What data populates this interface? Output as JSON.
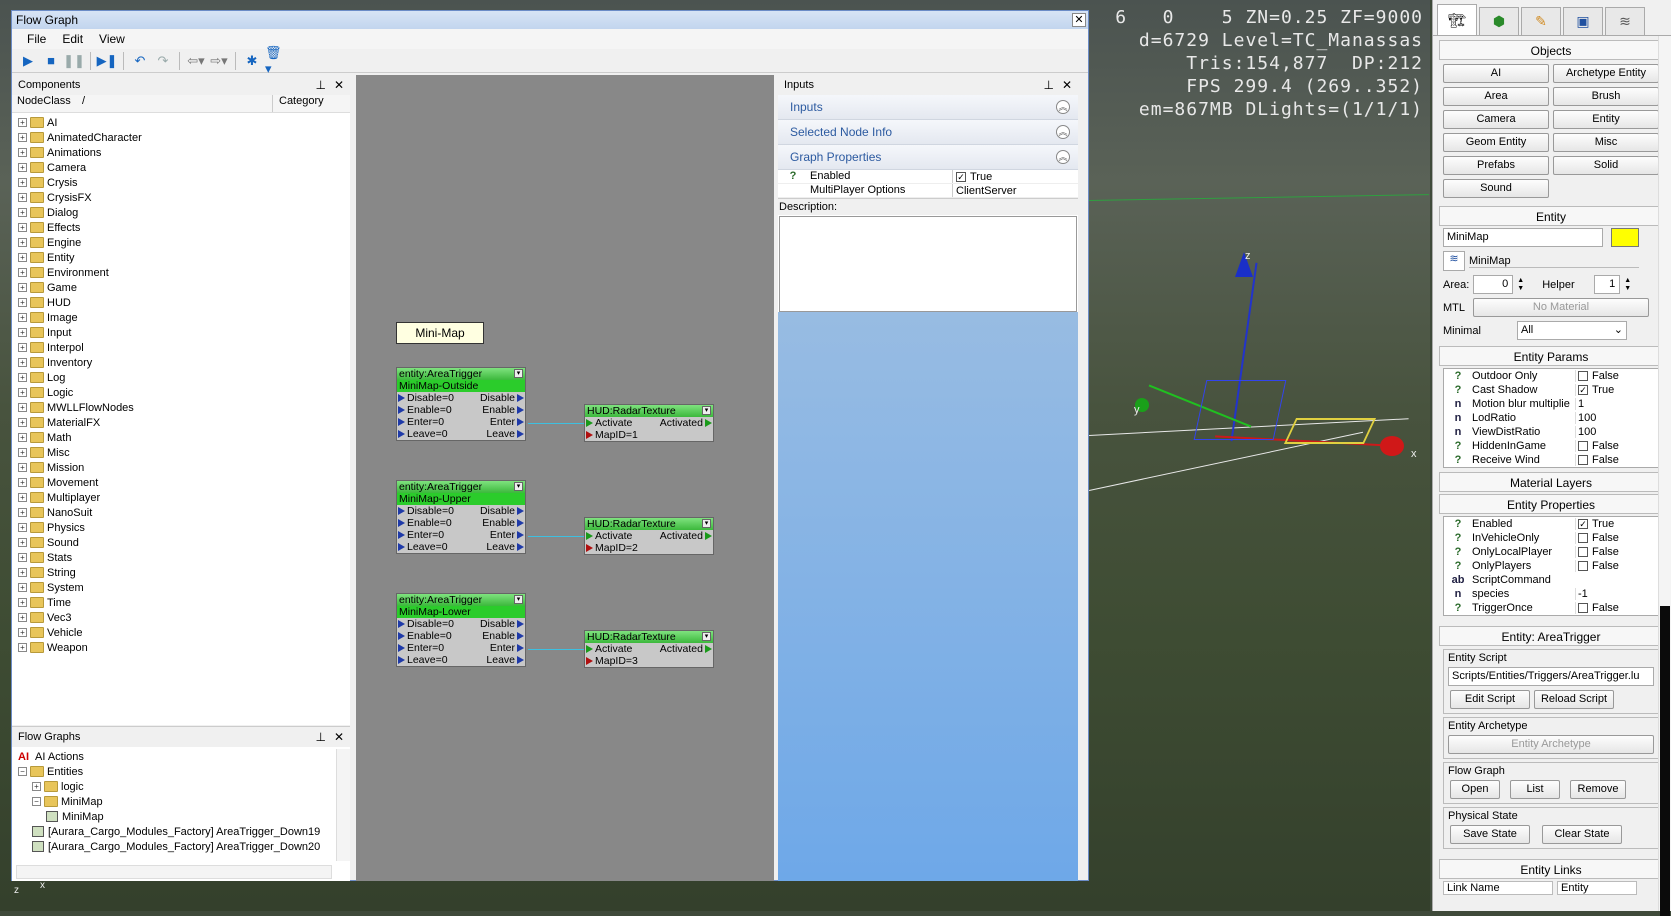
{
  "viewport": {
    "stats": [
      "6   0    5 ZN=0.25 ZF=9000",
      "d=6729 Level=TC_Manassas",
      "Tris:154,877  DP:212",
      "FPS 299.4 (269..352)",
      "em=867MB DLights=(1/1/1)"
    ],
    "axis_x": "x",
    "axis_y": "y",
    "axis_z": "z",
    "bottom_x": "x",
    "bottom_z": "z"
  },
  "window": {
    "title": "Flow Graph",
    "close": "✕"
  },
  "menu": [
    "File",
    "Edit",
    "View"
  ],
  "components": {
    "title": "Components",
    "col_nodeclass": "NodeClass",
    "col_sort": "/",
    "col_category": "Category",
    "items": [
      "AI",
      "AnimatedCharacter",
      "Animations",
      "Camera",
      "Crysis",
      "CrysisFX",
      "Dialog",
      "Effects",
      "Engine",
      "Entity",
      "Environment",
      "Game",
      "HUD",
      "Image",
      "Input",
      "Interpol",
      "Inventory",
      "Log",
      "Logic",
      "MWLLFlowNodes",
      "MaterialFX",
      "Math",
      "Misc",
      "Mission",
      "Movement",
      "Multiplayer",
      "NanoSuit",
      "Physics",
      "Sound",
      "Stats",
      "String",
      "System",
      "Time",
      "Vec3",
      "Vehicle",
      "Weapon"
    ]
  },
  "flowgraphs": {
    "title": "Flow Graphs",
    "items": [
      {
        "icon": "AI",
        "label": "AI Actions",
        "level": 0
      },
      {
        "label": "Entities",
        "level": 0
      },
      {
        "label": "logic",
        "level": 1
      },
      {
        "label": "MiniMap",
        "level": 1
      },
      {
        "label": "MiniMap",
        "level": 2
      },
      {
        "label": "[Aurara_Cargo_Modules_Factory] AreaTrigger_Down19",
        "level": 1
      },
      {
        "label": "[Aurara_Cargo_Modules_Factory] AreaTrigger_Down20",
        "level": 1
      }
    ]
  },
  "graph": {
    "comment": "Mini-Map",
    "triggers": [
      {
        "type": "entity:AreaTrigger",
        "name": "MiniMap-Outside"
      },
      {
        "type": "entity:AreaTrigger",
        "name": "MiniMap-Upper"
      },
      {
        "type": "entity:AreaTrigger",
        "name": "MiniMap-Lower"
      }
    ],
    "trigger_ports": {
      "in": [
        "Disable=0",
        "Enable=0",
        "Enter=0",
        "Leave=0"
      ],
      "out": [
        "Disable",
        "Enable",
        "Enter",
        "Leave"
      ]
    },
    "radars": [
      {
        "type": "HUD:RadarTexture",
        "in": "Activate",
        "out": "Activated",
        "param": "MapID=1"
      },
      {
        "type": "HUD:RadarTexture",
        "in": "Activate",
        "out": "Activated",
        "param": "MapID=2"
      },
      {
        "type": "HUD:RadarTexture",
        "in": "Activate",
        "out": "Activated",
        "param": "MapID=3"
      }
    ]
  },
  "inputs": {
    "title": "Inputs",
    "sections": [
      "Inputs",
      "Selected Node Info",
      "Graph Properties"
    ],
    "props": [
      {
        "q": "?",
        "name": "Enabled",
        "value": "True",
        "check": true
      },
      {
        "q": "",
        "name": "MultiPlayer Options",
        "value": "ClientServer",
        "check": false
      }
    ],
    "description_label": "Description:"
  },
  "right": {
    "objects_title": "Objects",
    "objects": [
      "AI",
      "Archetype Entity",
      "Area",
      "Brush",
      "Camera",
      "Entity",
      "Geom Entity",
      "Misc",
      "Prefabs",
      "Solid",
      "Sound"
    ],
    "entity_title": "Entity",
    "entity_name": "MiniMap",
    "entity_color": "#ffff00",
    "layer": "MiniMap",
    "area_label": "Area:",
    "area_value": "0",
    "helper_label": "Helper",
    "helper_value": "1",
    "mtl_label": "MTL",
    "mtl_value": "No Material",
    "minimal_label": "Minimal",
    "minimal_value": "All",
    "params_title": "Entity Params",
    "params": [
      {
        "q": "?",
        "name": "Outdoor Only",
        "value": "False",
        "cb": "off"
      },
      {
        "q": "?",
        "name": "Cast Shadow",
        "value": "True",
        "cb": "on"
      },
      {
        "q": "n",
        "name": "Motion blur multiplie",
        "value": "1",
        "cb": "none"
      },
      {
        "q": "n",
        "name": "LodRatio",
        "value": "100",
        "cb": "none"
      },
      {
        "q": "n",
        "name": "ViewDistRatio",
        "value": "100",
        "cb": "none"
      },
      {
        "q": "?",
        "name": "HiddenInGame",
        "value": "False",
        "cb": "off"
      },
      {
        "q": "?",
        "name": "Receive Wind",
        "value": "False",
        "cb": "off"
      }
    ],
    "material_layers": "Material Layers",
    "eprops_title": "Entity Properties",
    "eprops": [
      {
        "q": "?",
        "name": "Enabled",
        "value": "True",
        "cb": "on"
      },
      {
        "q": "?",
        "name": "InVehicleOnly",
        "value": "False",
        "cb": "off"
      },
      {
        "q": "?",
        "name": "OnlyLocalPlayer",
        "value": "False",
        "cb": "off"
      },
      {
        "q": "?",
        "name": "OnlyPlayers",
        "value": "False",
        "cb": "off"
      },
      {
        "q": "ab",
        "name": "ScriptCommand",
        "value": "",
        "cb": "none"
      },
      {
        "q": "n",
        "name": "species",
        "value": "-1",
        "cb": "none"
      },
      {
        "q": "?",
        "name": "TriggerOnce",
        "value": "False",
        "cb": "off"
      }
    ],
    "area_trigger_title": "Entity: AreaTrigger",
    "script_label": "Entity Script",
    "script_path": "Scripts/Entities/Triggers/AreaTrigger.lu",
    "edit_script": "Edit Script",
    "reload_script": "Reload Script",
    "archetype_label": "Entity Archetype",
    "archetype_value": "Entity Archetype",
    "flowgraph_label": "Flow Graph",
    "fg_open": "Open",
    "fg_list": "List",
    "fg_remove": "Remove",
    "physical_label": "Physical State",
    "save_state": "Save State",
    "clear_state": "Clear State",
    "links_title": "Entity Links",
    "link_col1": "Link Name",
    "link_col2": "Entity"
  }
}
